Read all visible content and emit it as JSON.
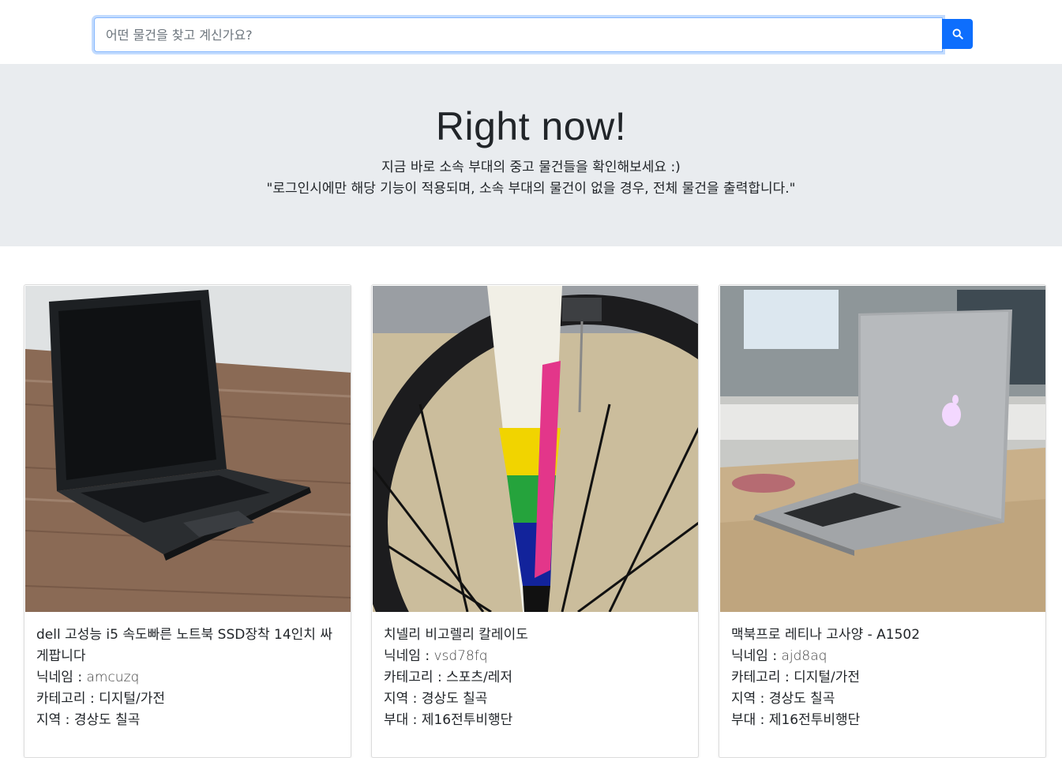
{
  "search": {
    "placeholder": "어떤 물건을 찾고 계신가요?",
    "value": ""
  },
  "hero": {
    "title": "Right now!",
    "subtitle": "지금 바로 소속 부대의 중고 물건들을 확인해보세요 :)",
    "notice": "\"로그인시에만 해당 기능이 적용되며, 소속 부대의 물건이 없을 경우, 전체 물건을 출력합니다.\""
  },
  "labels": {
    "nickname": "닉네임 : ",
    "category": "카테고리 : ",
    "region": "지역 : ",
    "unit": "부대 : "
  },
  "products": [
    {
      "title": "dell 고성능 i5 속도빠른 노트북 SSD장착 14인치 싸게팝니다",
      "nickname": "amcuzq",
      "category": "디지털/가전",
      "region": "경상도 칠곡",
      "image": "laptop-on-wood-table"
    },
    {
      "title": "치넬리 비고렐리 칼레이도",
      "nickname": "vsd78fq",
      "category": "스포츠/레저",
      "region": "경상도 칠곡",
      "unit": "제16전투비행단",
      "image": "bicycle-fork-wheel"
    },
    {
      "title": "맥북프로 레티나 고사양 - A1502",
      "nickname": "ajd8aq",
      "category": "디지털/가전",
      "region": "경상도 칠곡",
      "unit": "제16전투비행단",
      "image": "macbook-on-table"
    }
  ]
}
